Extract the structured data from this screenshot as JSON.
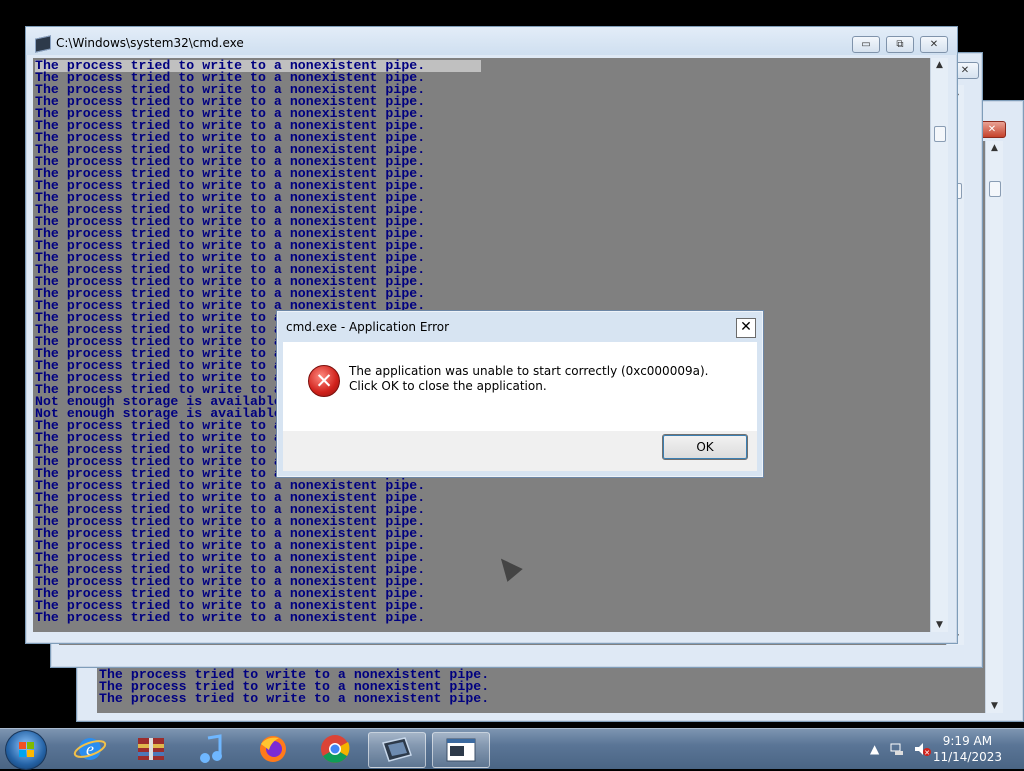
{
  "main_window": {
    "title": "C:\\Windows\\system32\\cmd.exe",
    "minimize_label": "▭",
    "restore_label": "⧉",
    "close_label": "✕",
    "console_lines": [
      "The process tried to write to a nonexistent pipe.",
      "The process tried to write to a nonexistent pipe.",
      "The process tried to write to a nonexistent pipe.",
      "The process tried to write to a nonexistent pipe.",
      "The process tried to write to a nonexistent pipe.",
      "The process tried to write to a nonexistent pipe.",
      "The process tried to write to a nonexistent pipe.",
      "The process tried to write to a nonexistent pipe.",
      "The process tried to write to a nonexistent pipe.",
      "The process tried to write to a nonexistent pipe.",
      "The process tried to write to a nonexistent pipe.",
      "The process tried to write to a nonexistent pipe.",
      "The process tried to write to a nonexistent pipe.",
      "The process tried to write to a nonexistent pipe.",
      "The process tried to write to a nonexistent pipe.",
      "The process tried to write to a nonexistent pipe.",
      "The process tried to write to a nonexistent pipe.",
      "The process tried to write to a nonexistent pipe.",
      "The process tried to write to a nonexistent pipe.",
      "The process tried to write to a nonexistent pipe.",
      "The process tried to write to a nonexistent pipe.",
      "The process tried to write to a nonexistent pipe.",
      "The process tried to write to a nonexistent pipe.",
      "The process tried to write to a nonexistent pipe.",
      "The process tried to write to a nonexistent pipe.",
      "The process tried to write to a nonexistent pipe.",
      "The process tried to write to a nonexistent pipe.",
      "The process tried to write to a nonexistent pipe.",
      "Not enough storage is available to process this command.",
      "Not enough storage is available to process this command.",
      "The process tried to write to a nonexistent pipe.",
      "The process tried to write to a nonexistent pipe.",
      "The process tried to write to a nonexistent pipe.",
      "The process tried to write to a nonexistent pipe.",
      "The process tried to write to a nonexistent pipe.",
      "The process tried to write to a nonexistent pipe.",
      "The process tried to write to a nonexistent pipe.",
      "The process tried to write to a nonexistent pipe.",
      "The process tried to write to a nonexistent pipe.",
      "The process tried to write to a nonexistent pipe.",
      "The process tried to write to a nonexistent pipe.",
      "The process tried to write to a nonexistent pipe.",
      "The process tried to write to a nonexistent pipe.",
      "The process tried to write to a nonexistent pipe.",
      "The process tried to write to a nonexistent pipe.",
      "The process tried to write to a nonexistent pipe.",
      "The process tried to write to a nonexistent pipe."
    ]
  },
  "back_window_3": {
    "console_lines": [
      "The process tried to write to a nonexistent pipe.",
      "The process tried to write to a nonexistent pipe.",
      "The process tried to write to a nonexistent pipe."
    ]
  },
  "dialog": {
    "title": "cmd.exe - Application Error",
    "close_label": "✕",
    "icon_glyph": "✕",
    "message": "The application was unable to start correctly (0xc000009a). Click OK to close the application.",
    "ok_label": "OK"
  },
  "taskbar": {
    "time": "9:19 AM",
    "date": "11/14/2023",
    "items": [
      {
        "name": "internet-explorer-icon"
      },
      {
        "name": "archive-manager-icon"
      },
      {
        "name": "media-player-icon"
      },
      {
        "name": "firefox-icon"
      },
      {
        "name": "chrome-icon"
      },
      {
        "name": "cmd-window-icon"
      },
      {
        "name": "console-window-icon"
      }
    ]
  },
  "colors": {
    "console_bg": "#808080",
    "console_text": "#000080",
    "error_red": "#d0211b"
  }
}
